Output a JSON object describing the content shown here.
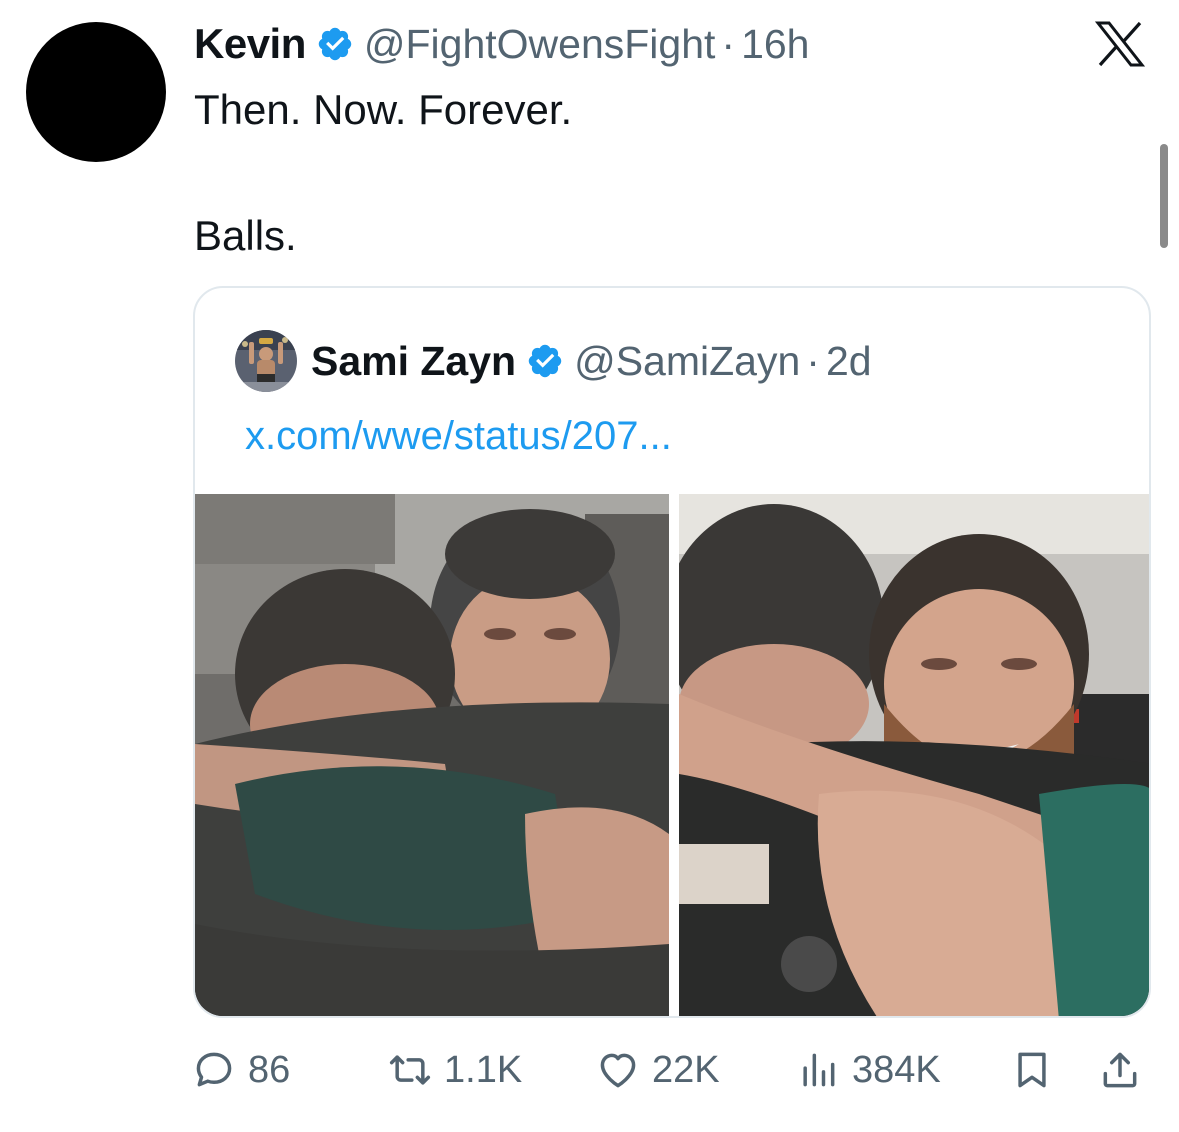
{
  "author": {
    "display_name": "Kevin",
    "handle": "@FightOwensFight",
    "separator": "·",
    "time": "16h",
    "verified_icon": "verified-badge-icon",
    "avatar_color": "#000000"
  },
  "tweet": {
    "lines": [
      "Then. Now. Forever.",
      "Balls."
    ]
  },
  "quoted": {
    "display_name": "Sami Zayn",
    "handle": "@SamiZayn",
    "separator": "·",
    "time": "2d",
    "link_text": "x.com/wwe/status/207...",
    "link_color": "#1d9bf0"
  },
  "actions": {
    "replies": "86",
    "reposts": "1.1K",
    "likes": "22K",
    "views": "384K"
  },
  "colors": {
    "text": "#0f1419",
    "secondary": "#536471",
    "verified": "#1d9bf0",
    "border": "#e1e8ed"
  }
}
